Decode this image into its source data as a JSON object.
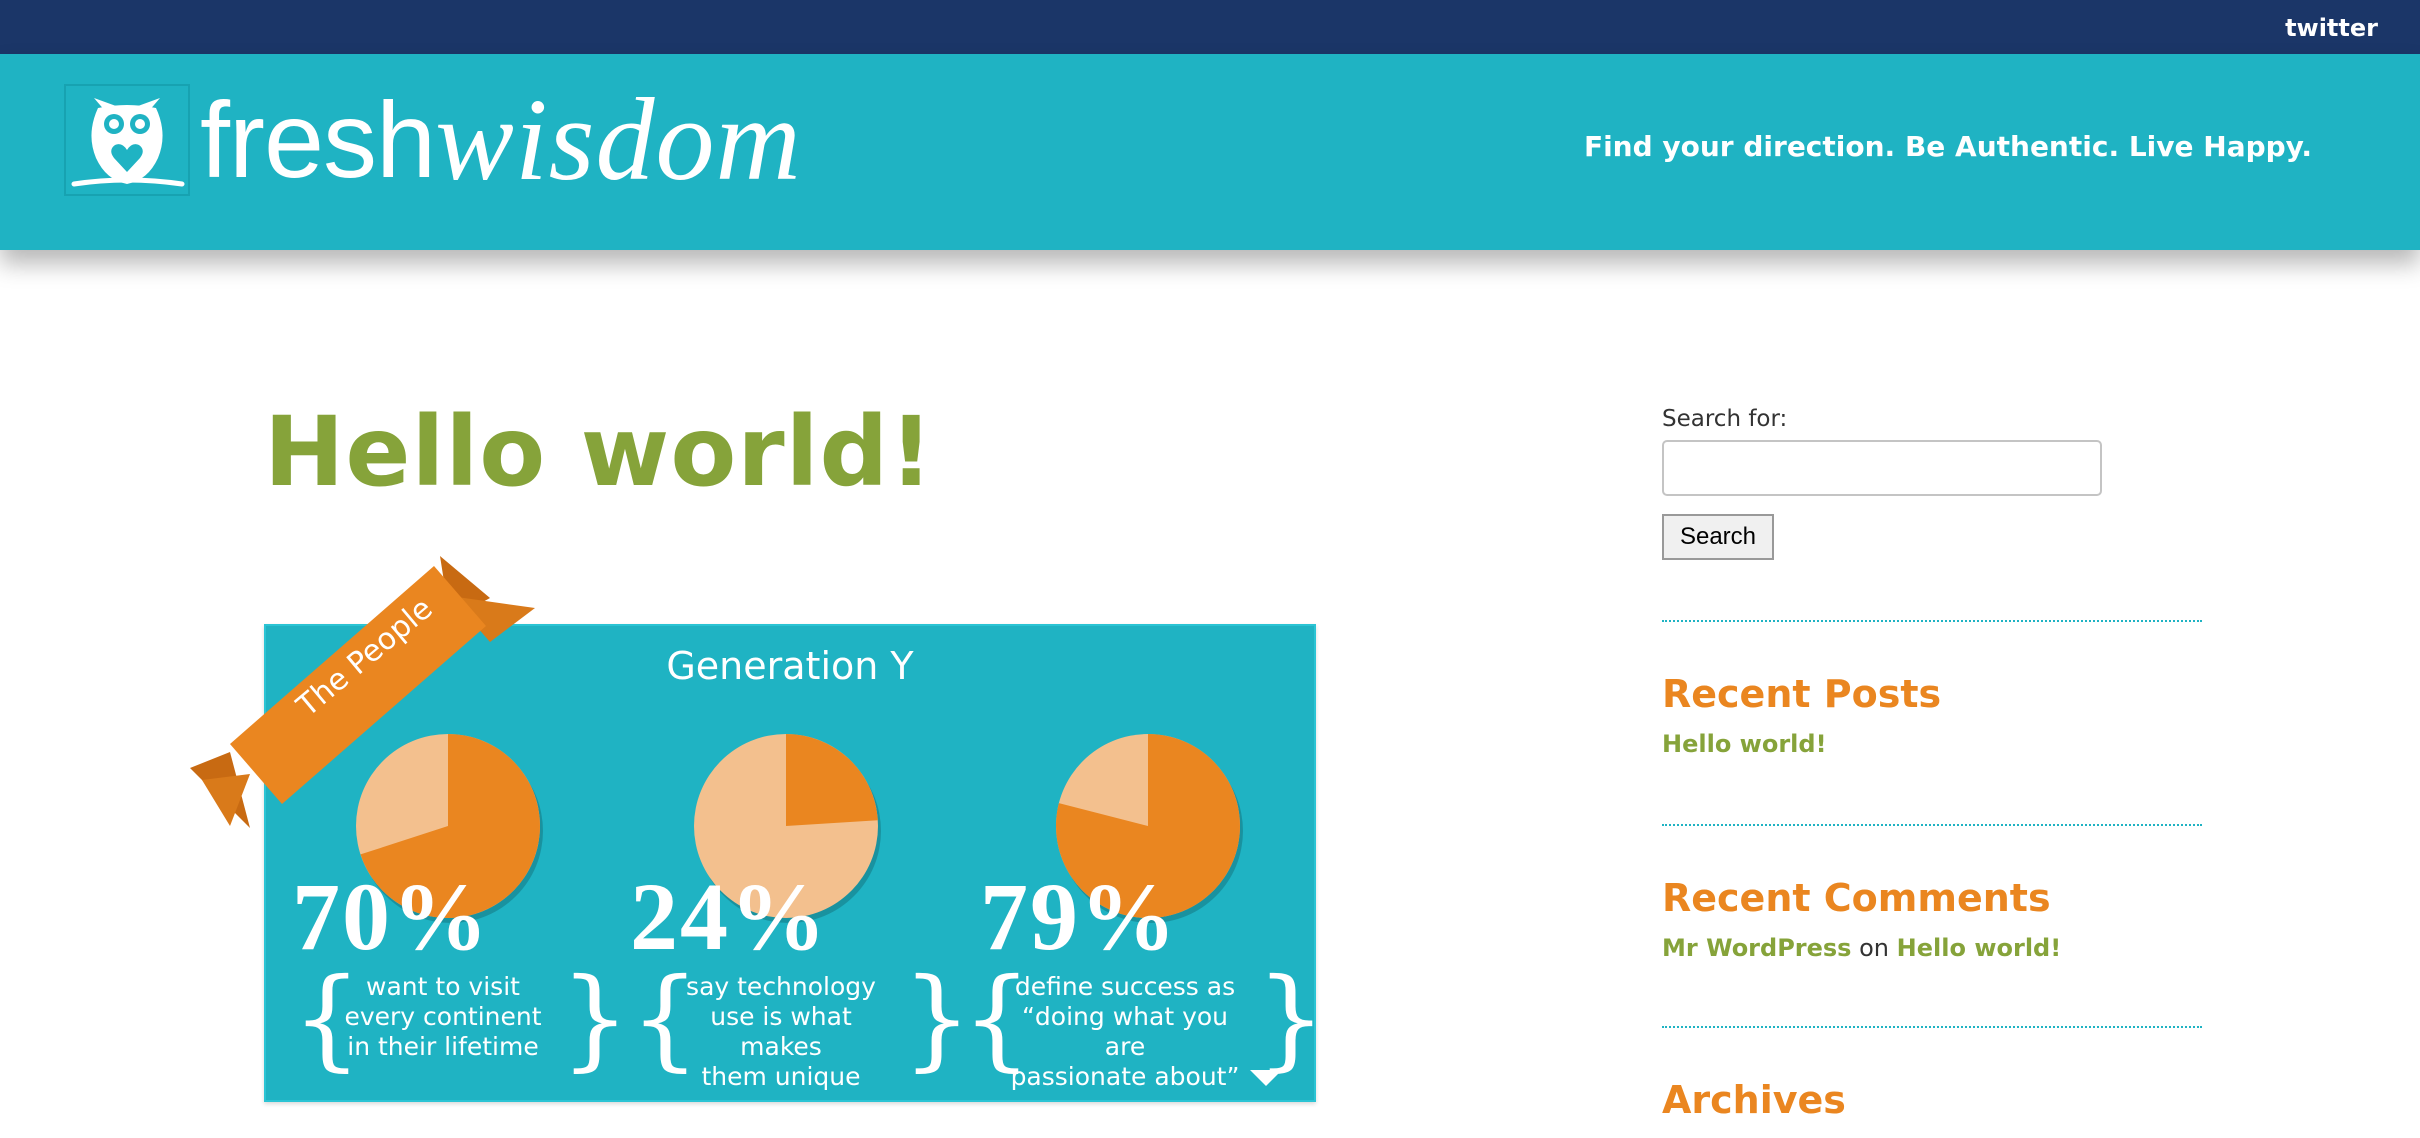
{
  "topbar": {
    "twitter_label": "twitter"
  },
  "header": {
    "logo_part1": "fresh",
    "logo_part2": "wisdom",
    "tagline": "Find your direction. Be Authentic. Live Happy."
  },
  "post": {
    "title": "Hello world!",
    "infographic": {
      "ribbon": "The People",
      "title": "Generation Y",
      "stats": [
        {
          "value": "70%",
          "percent": 70,
          "lines": [
            "want to visit",
            "every continent",
            "in their lifetime"
          ]
        },
        {
          "value": "24%",
          "percent": 24,
          "lines": [
            "say technology",
            "use is what makes",
            "them unique"
          ]
        },
        {
          "value": "79%",
          "percent": 79,
          "lines": [
            "define success as",
            "“doing what you are",
            "passionate about”"
          ]
        }
      ]
    }
  },
  "sidebar": {
    "search_label": "Search for:",
    "search_value": "",
    "search_button": "Search",
    "recent_posts_title": "Recent Posts",
    "recent_posts": [
      "Hello world!"
    ],
    "recent_comments_title": "Recent Comments",
    "recent_comment": {
      "author": "Mr WordPress",
      "connector": "on",
      "post": "Hello world!"
    },
    "archives_title": "Archives"
  },
  "colors": {
    "topbar": "#1b3668",
    "teal": "#1fb3c3",
    "green": "#86a33a",
    "orange": "#ea8620",
    "pie_light": "#f3c08e"
  },
  "icons": {
    "logo": "owl-icon",
    "more": "caret-down-icon"
  }
}
